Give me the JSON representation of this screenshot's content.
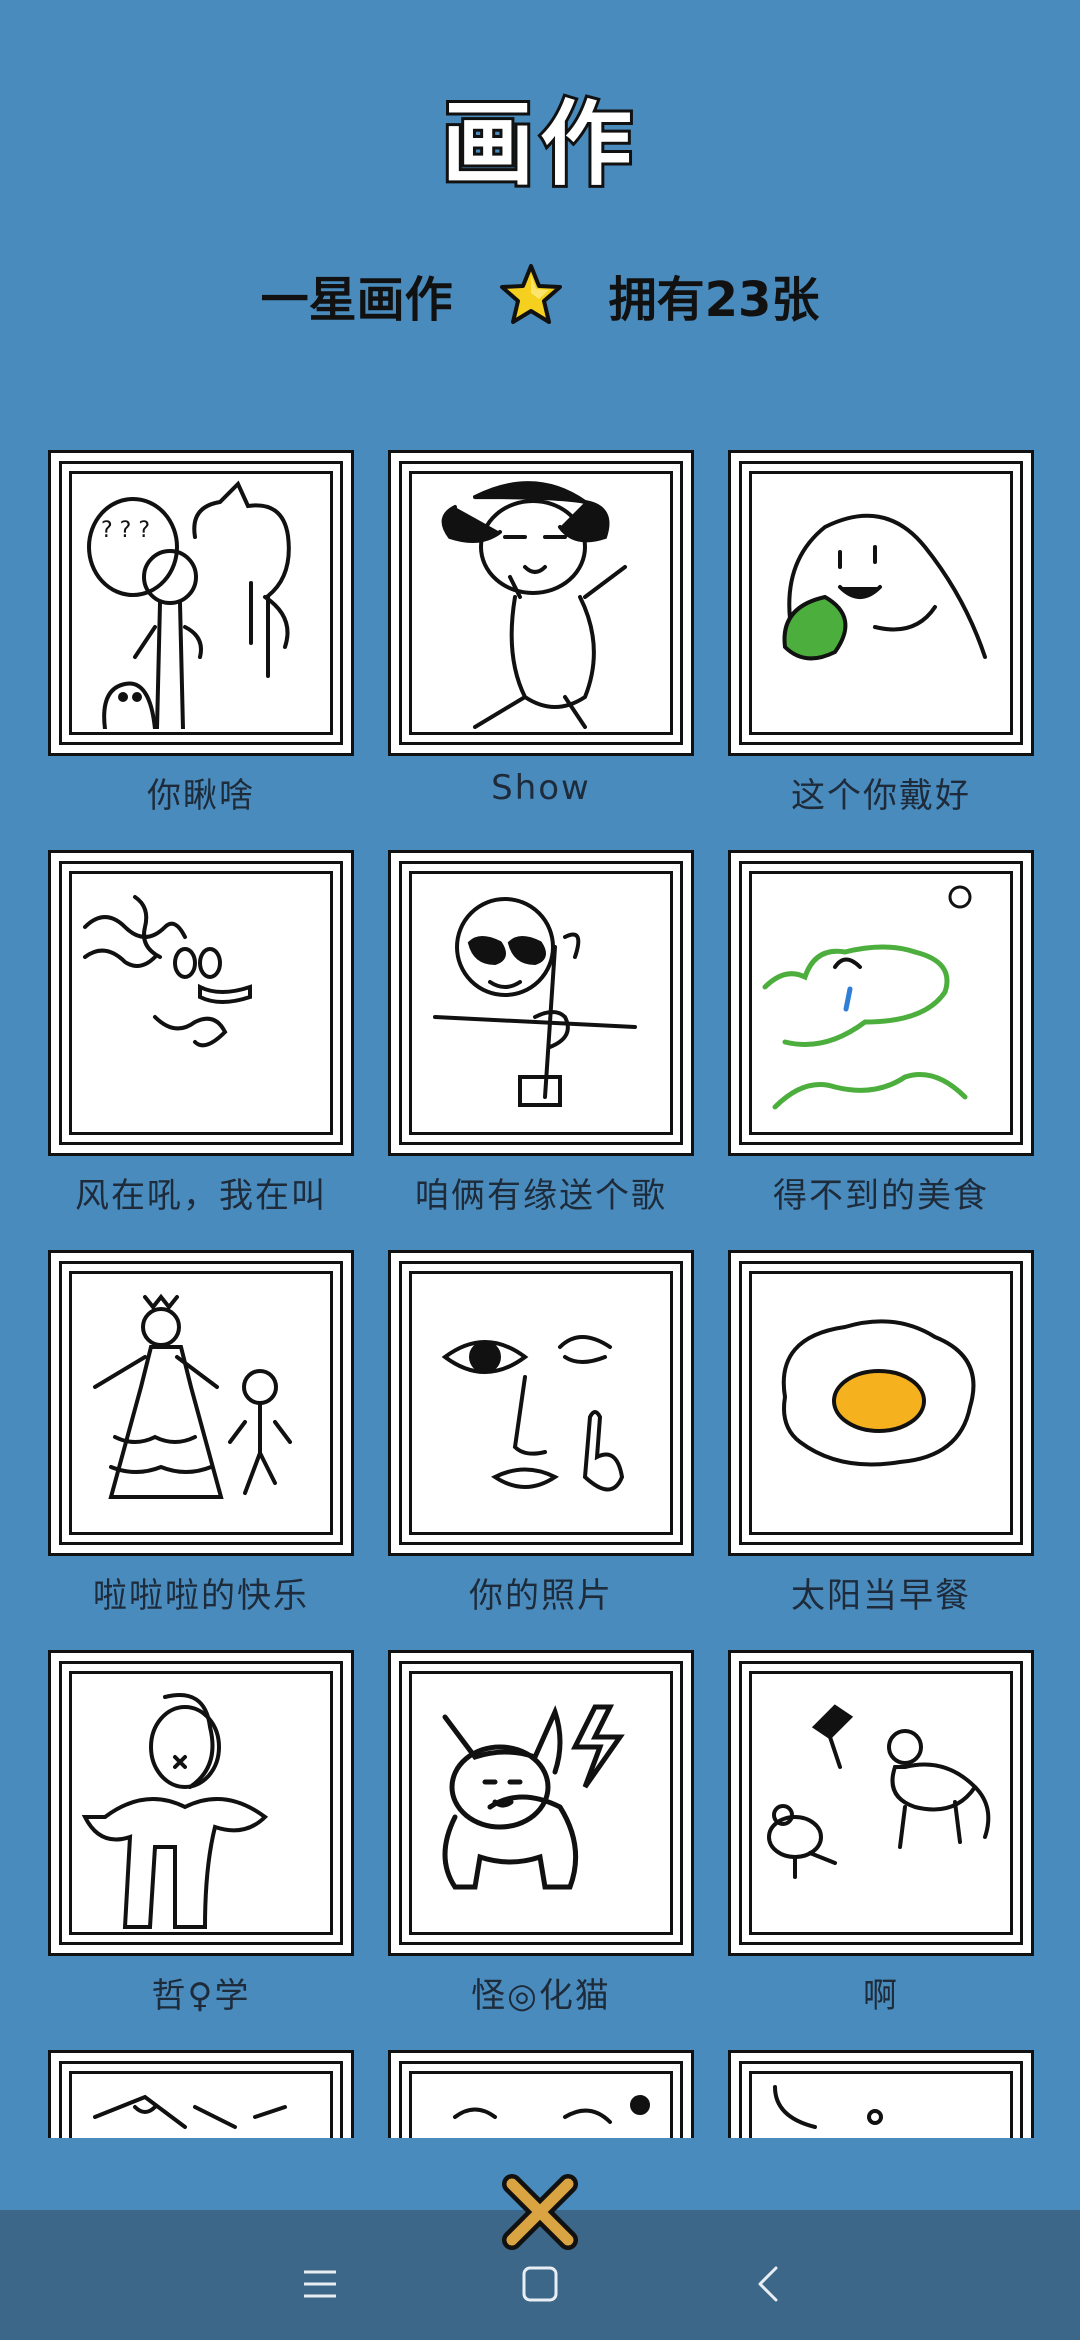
{
  "header": {
    "title": "画作"
  },
  "summary": {
    "category": "一星画作",
    "owned": "拥有23张",
    "star_icon": "star-icon"
  },
  "gallery": {
    "paintings": [
      {
        "label": "你瞅啥"
      },
      {
        "label": "Show"
      },
      {
        "label": "这个你戴好"
      },
      {
        "label": "风在吼，我在叫"
      },
      {
        "label": "咱俩有缘送个歌"
      },
      {
        "label": "得不到的美食"
      },
      {
        "label": "啦啦啦的快乐"
      },
      {
        "label": "你的照片"
      },
      {
        "label": "太阳当早餐"
      },
      {
        "label": "哲♀学"
      },
      {
        "label": "怪◎化猫"
      },
      {
        "label": "啊"
      },
      {
        "label": ""
      },
      {
        "label": ""
      },
      {
        "label": ""
      }
    ]
  },
  "colors": {
    "background": "#4a8bbd",
    "navbar": "#3c6788",
    "close": "#d9a441",
    "star": "#f5d01e"
  },
  "nav": {
    "menu_icon": "menu-icon",
    "home_icon": "home-square-icon",
    "back_icon": "back-chevron-icon",
    "close_icon": "close-x-icon"
  }
}
